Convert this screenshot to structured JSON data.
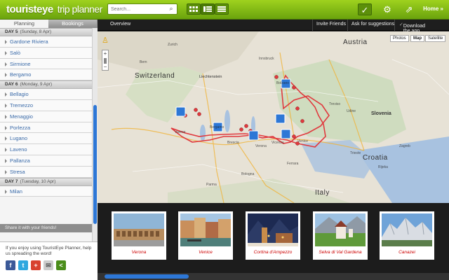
{
  "header": {
    "logo_brand": "touristeye",
    "logo_product": "trip planner",
    "search_placeholder": "Search...",
    "home_label": "Home »"
  },
  "tabs": [
    "Planning",
    "Bookings"
  ],
  "days": [
    {
      "label": "DAY 5",
      "date": "(Sunday, 8 Apr)",
      "places": [
        "Gardone Riviera",
        "Salò",
        "Sirmione",
        "Bergamo"
      ]
    },
    {
      "label": "DAY 6",
      "date": "(Monday, 9 Apr)",
      "places": [
        "Bellagio",
        "Tremezzo",
        "Menaggio",
        "Porlezza",
        "Lugano",
        "Laveno",
        "Pallanza",
        "Stresa"
      ]
    },
    {
      "label": "DAY 7",
      "date": "(Tuesday, 10 Apr)",
      "places": [
        "Milan"
      ]
    }
  ],
  "share": {
    "header": "Share it with your friends!",
    "text": "If you enjoy using TouristEye Planner, help us spreading the word!"
  },
  "subbar": {
    "overview": "Overview",
    "invite": "Invite Friends",
    "suggestions": "Ask for suggestions",
    "download": "Download the app"
  },
  "map": {
    "controls": [
      "Photos",
      "Map",
      "Satellite"
    ],
    "labels": [
      "Austria",
      "Switzerland",
      "Liechtenstein",
      "Slovenia",
      "Croatia",
      "Italy"
    ],
    "route_color": "#e0393e"
  },
  "photos": [
    {
      "caption": "Verona"
    },
    {
      "caption": "Venice"
    },
    {
      "caption": "Cortina d'Ampezzo"
    },
    {
      "caption": "Selva di Val Gardena"
    },
    {
      "caption": "Canazei"
    }
  ],
  "colors": {
    "accent": "#8cc31a",
    "link": "#3a6aa8"
  }
}
